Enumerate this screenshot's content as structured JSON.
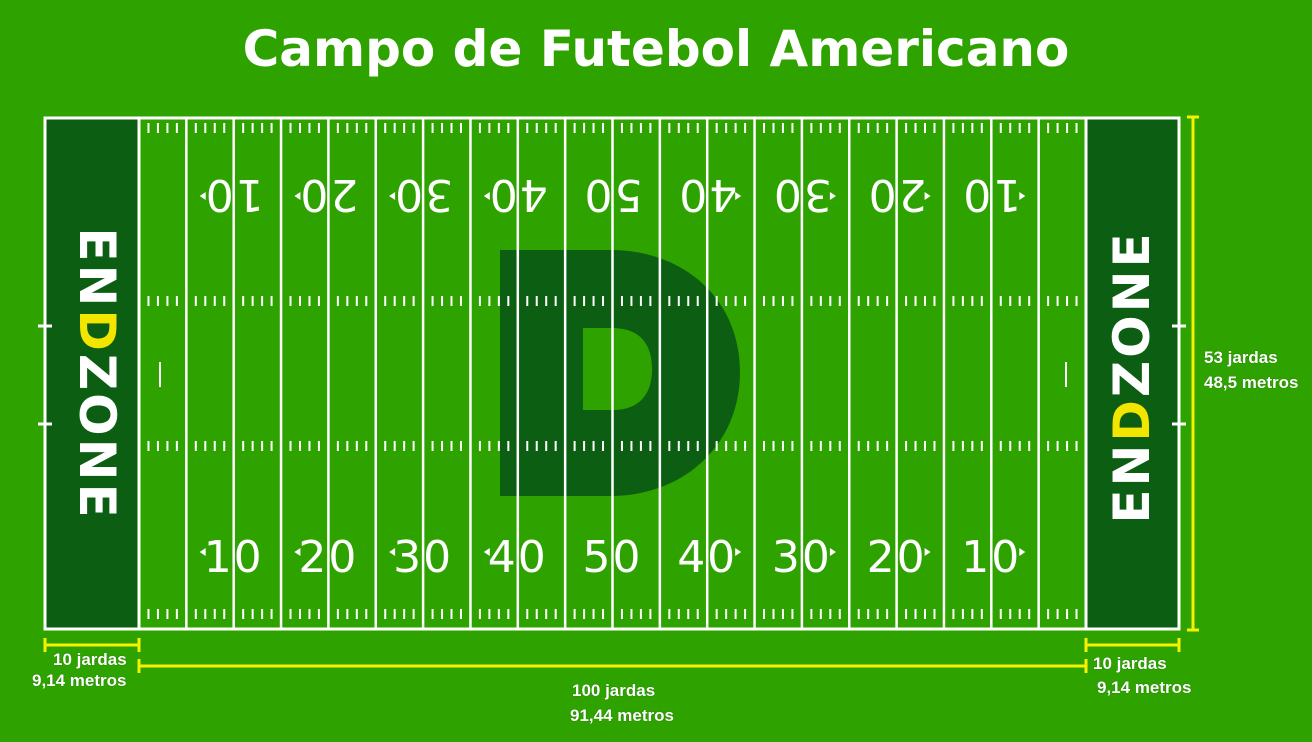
{
  "title": "Campo de Futebol Americano",
  "endzone": {
    "text_start": "EN",
    "text_mid": "D",
    "text_end": "ZONE"
  },
  "yard_numbers": [
    "10",
    "20",
    "30",
    "40",
    "50",
    "40",
    "30",
    "20",
    "10"
  ],
  "logo": {
    "letter": "D"
  },
  "dimensions": {
    "width_yards": "53 jardas",
    "width_meters": "48,5 metros",
    "endzone_left_yards": "10 jardas",
    "endzone_left_meters": "9,14 metros",
    "endzone_right_yards": "10 jardas",
    "endzone_right_meters": "9,14 metros",
    "length_yards": "100 jardas",
    "length_meters": "91,44 metros"
  },
  "colors": {
    "grass": "#2ea300",
    "endzone": "#0c5e12",
    "lines": "#ffffff",
    "logo": "#0c5e12",
    "measure": "#f7f000",
    "endzone_letter": "#f2e600"
  }
}
